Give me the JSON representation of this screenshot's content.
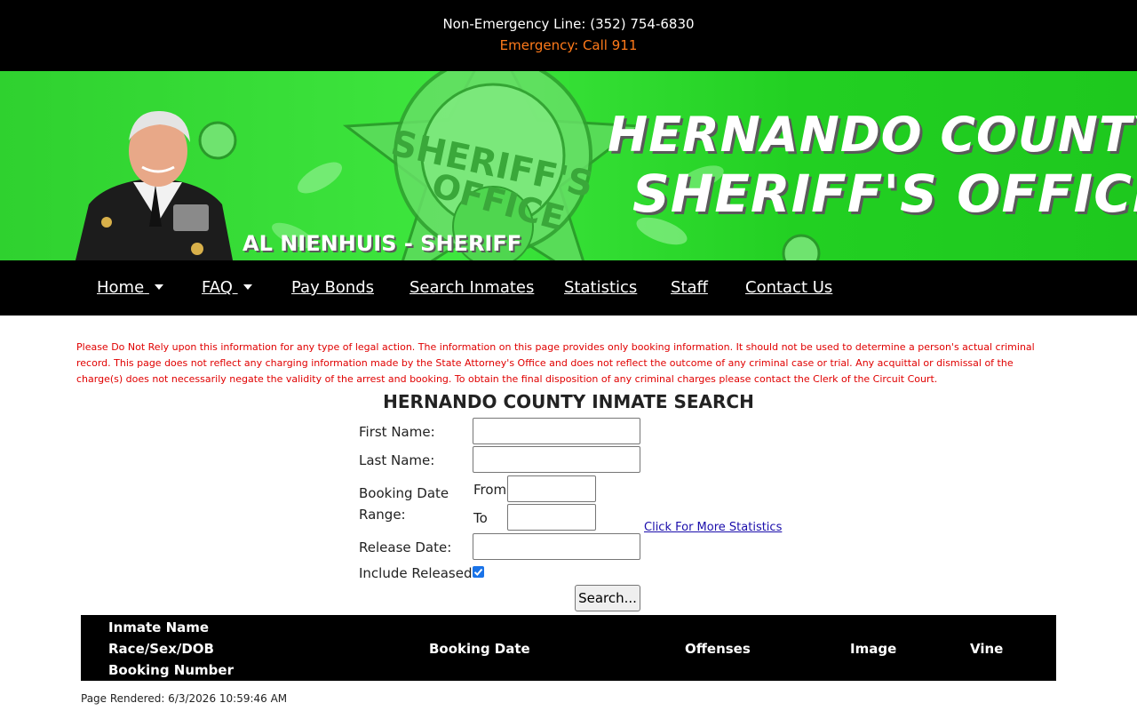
{
  "topbar": {
    "non_emergency": "Non-Emergency Line: (352) 754-6830",
    "emergency": "Emergency: Call 911",
    "emergency_color": "#ff7a1a"
  },
  "banner": {
    "title_line1": "HERNANDO COUNTY",
    "title_line2": "SHERIFF'S OFFICE",
    "badge_line1": "SHERIFF'S",
    "badge_line2": "OFFICE",
    "sheriff_name": "AL NIENHUIS - SHERIFF",
    "brand_color": "#2fd12f"
  },
  "nav": {
    "items": [
      {
        "label": "Home",
        "dropdown": true
      },
      {
        "label": "FAQ",
        "dropdown": true
      },
      {
        "label": "Pay Bonds"
      },
      {
        "label": "Search Inmates"
      },
      {
        "label": "Statistics"
      },
      {
        "label": "Staff"
      },
      {
        "label": "Contact Us"
      }
    ]
  },
  "disclaimer": "Please Do Not Rely upon this information for any type of legal action. The information on this page provides only booking information. It should not be used to determine a person's actual criminal record. This page does not reflect any charging information made by the State Attorney's Office and does not reflect the outcome of any criminal case or trial. Any acquittal or dismissal of the charge(s) does not necessarily negate the validity of the arrest and booking. To obtain the final disposition of any criminal charges please contact the Clerk of the Circuit Court.",
  "search": {
    "title": "HERNANDO COUNTY INMATE SEARCH",
    "first_name_label": "First Name:",
    "first_name_value": "",
    "last_name_label": "Last Name:",
    "last_name_value": "",
    "booking_date_label_1": "Booking Date",
    "booking_date_label_2": "Range:",
    "from_label": "From",
    "from_value": "",
    "to_label": "To",
    "to_value": "",
    "release_date_label": "Release Date:",
    "release_date_value": "",
    "include_released_label": "Include Released?",
    "include_released_checked": true,
    "more_stats_link": "Click For More Statistics",
    "search_button": "Search..."
  },
  "table": {
    "headers": {
      "inmate_name": "Inmate Name",
      "race_sex_dob": "Race/Sex/DOB",
      "booking_number": "Booking Number",
      "booking_date": "Booking Date",
      "offenses": "Offenses",
      "image": "Image",
      "vine": "Vine"
    }
  },
  "footer": {
    "rendered": "Page Rendered: 6/3/2026 10:59:46 AM"
  }
}
